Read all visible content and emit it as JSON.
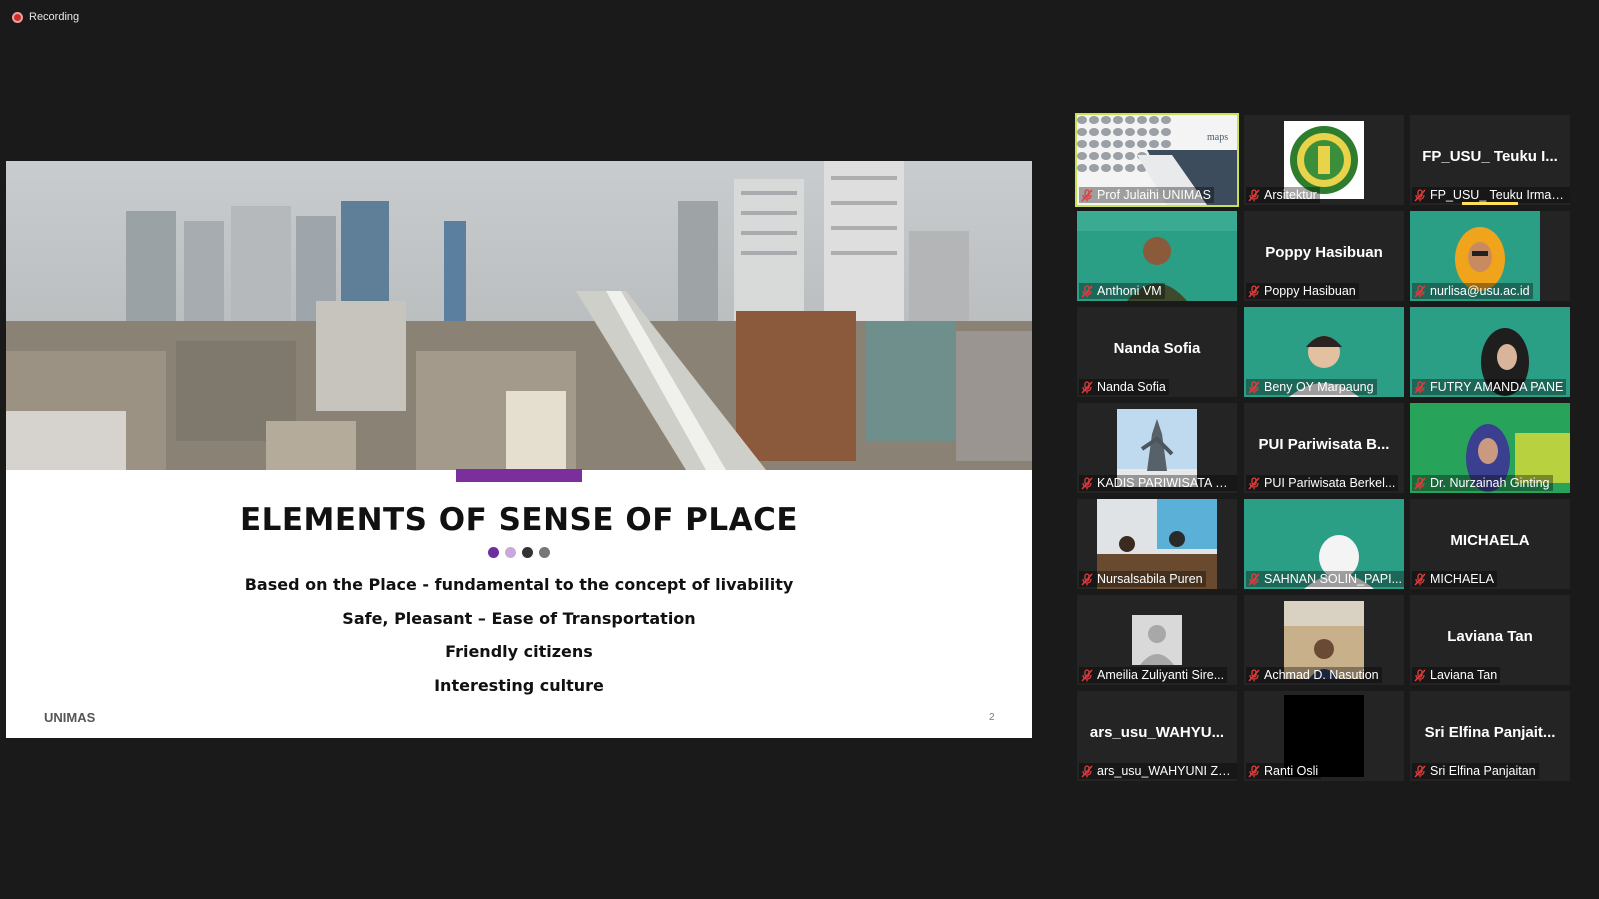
{
  "status": {
    "recording_label": "Recording"
  },
  "slide": {
    "title": "ELEMENTS OF SENSE OF PLACE",
    "bullets": [
      "Based on the Place - fundamental to the concept of livability",
      "Safe, Pleasant – Ease of Transportation",
      "Friendly citizens",
      "Interesting culture"
    ],
    "footer": "UNIMAS",
    "page_number": "2",
    "dot_colors": [
      "#6b2f9e",
      "#c9a9dc",
      "#333333",
      "#777777"
    ],
    "accent_color": "#7a2f9c"
  },
  "thumbnails": {
    "maps_brand": "maps"
  },
  "participants": [
    {
      "name": "Prof Julaihi UNIMAS",
      "display": "",
      "video": "slide-share",
      "active": true
    },
    {
      "name": "Arsitektur",
      "display": "",
      "video": "university-logo"
    },
    {
      "name": "FP_USU_ Teuku Irmansyah",
      "display": "FP_USU_ Teuku I..."
    },
    {
      "name": "Anthoni VM",
      "display": "",
      "video": "webcam-man"
    },
    {
      "name": "Poppy Hasibuan",
      "display": "Poppy Hasibuan"
    },
    {
      "name": "nurlisa@usu.ac.id",
      "display": "",
      "video": "webcam-woman-hijab"
    },
    {
      "name": "Nanda Sofia",
      "display": "Nanda Sofia"
    },
    {
      "name": "Beny OY Marpaung",
      "display": "",
      "video": "webcam-young-man"
    },
    {
      "name": "FUTRY AMANDA PANE",
      "display": "",
      "video": "webcam-woman-headset"
    },
    {
      "name": "KADIS PARIWISATA SI...",
      "display": "",
      "video": "monument-photo"
    },
    {
      "name": "PUI Pariwisata Berkel...",
      "display": "PUI  Pariwisata  B..."
    },
    {
      "name": "Dr. Nurzainah Ginting",
      "display": "",
      "video": "webcam-green-bg"
    },
    {
      "name": "Nursalsabila Puren",
      "display": "",
      "video": "meeting-room"
    },
    {
      "name": "SAHNAN SOLIN_PAPI...",
      "display": "",
      "video": "webcam-man-cap"
    },
    {
      "name": "MICHAELA",
      "display": "MICHAELA"
    },
    {
      "name": "Ameilia Zuliyanti Sire...",
      "display": "",
      "video": "default-avatar"
    },
    {
      "name": "Achmad D. Nasution",
      "display": "",
      "video": "city-photo"
    },
    {
      "name": "Laviana Tan",
      "display": "Laviana Tan"
    },
    {
      "name": "ars_usu_WAHYUNI ZA...",
      "display": "ars_usu_WAHYU..."
    },
    {
      "name": "Ranti Osli",
      "display": "",
      "video": "black-video"
    },
    {
      "name": "Sri Elfina Panjaitan",
      "display": "Sri  Elfina  Panjait..."
    }
  ]
}
